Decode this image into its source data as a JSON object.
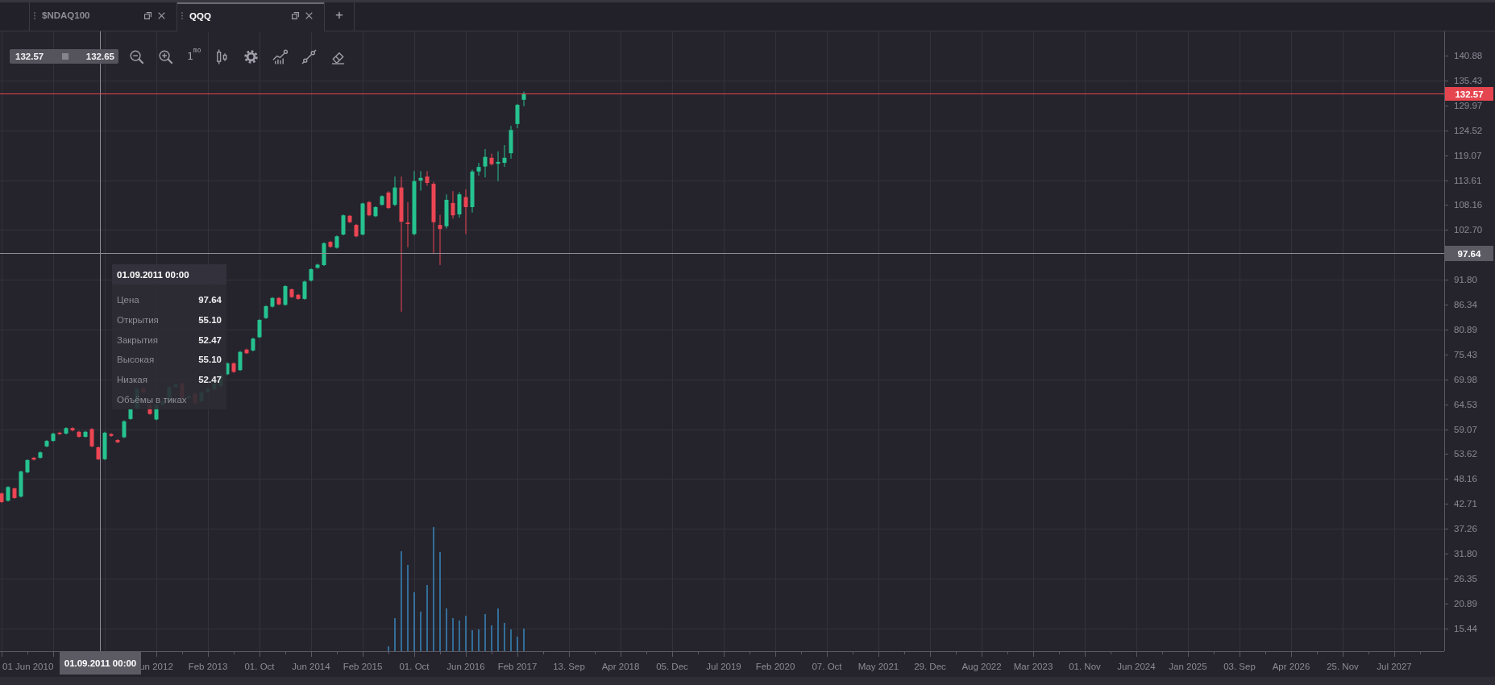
{
  "tabs": [
    {
      "label": "$NDAQ100",
      "selected": false
    },
    {
      "label": "QQQ",
      "selected": true
    }
  ],
  "new_tab_button": "+",
  "toolbar": {
    "bid": "132.57",
    "ask": "132.65",
    "timeframe": "1$^{mo}$"
  },
  "chart": {
    "y_axis": {
      "upper_ticks": [
        "140.88",
        "135.43",
        "129.97",
        "124.52",
        "119.07",
        "113.61",
        "108.16",
        "102.70"
      ],
      "lower_ticks": [
        "91.80",
        "86.34",
        "80.89",
        "75.43",
        "69.98",
        "64.53",
        "59.07",
        "53.62",
        "48.16",
        "42.71",
        "37.26",
        "31.80",
        "26.35",
        "20.89",
        "15.44"
      ]
    },
    "x_axis": {
      "labels": [
        "01 Jun 2010",
        "un 2012",
        "Feb 2013",
        "01. Oct",
        "Jun 2014",
        "Feb 2015",
        "01. Oct",
        "Jun 2016",
        "Feb 2017",
        "13. Sep",
        "Apr 2018",
        "05. Dec",
        "Jul 2019",
        "Feb 2020",
        "07. Oct",
        "May 2021",
        "29. Dec",
        "Aug 2022",
        "Mar 2023",
        "01. Nov",
        "Jun 2024",
        "Jan 2025",
        "03. Sep",
        "Apr 2026",
        "25. Nov",
        "Jul 2027"
      ]
    },
    "last_price_label": "132.57",
    "crosshair": {
      "price_label": "97.64",
      "date_label": "01.09.2011 00:00"
    },
    "tooltip": {
      "title": "01.09.2011 00:00",
      "rows": [
        {
          "label": "Цена",
          "value": "97.64"
        },
        {
          "label": "Открытия",
          "value": "55.10"
        },
        {
          "label": "Закрытия",
          "value": "52.47"
        },
        {
          "label": "Высокая",
          "value": "55.10"
        },
        {
          "label": "Низкая",
          "value": "52.47"
        }
      ],
      "footer": "Объёмы в тиках"
    }
  }
}
